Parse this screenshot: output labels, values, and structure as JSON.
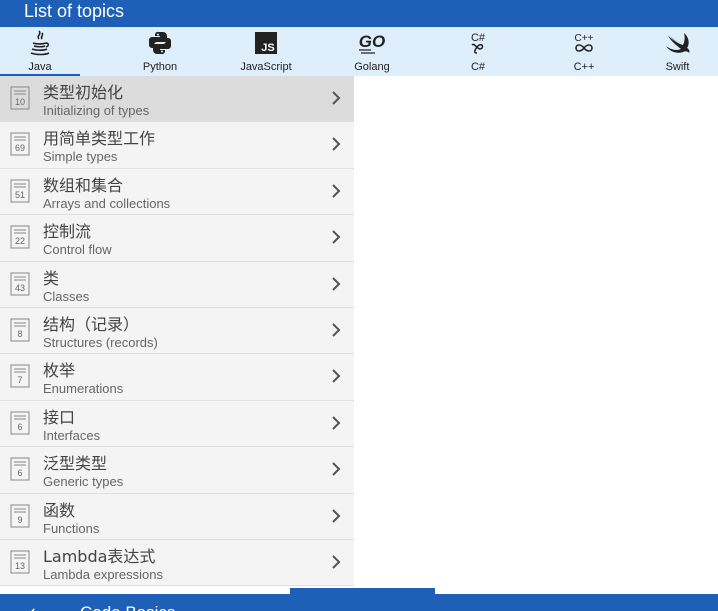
{
  "header": {
    "title": "List of topics"
  },
  "tabs": [
    {
      "label": "Java",
      "icon": "java-icon"
    },
    {
      "label": "Python",
      "icon": "python-icon"
    },
    {
      "label": "JavaScript",
      "icon": "javascript-icon"
    },
    {
      "label": "Golang",
      "icon": "golang-icon"
    },
    {
      "label": "C#",
      "icon": "csharp-icon"
    },
    {
      "label": "C++",
      "icon": "cpp-icon"
    },
    {
      "label": "Swift",
      "icon": "swift-icon"
    }
  ],
  "topics": [
    {
      "count": "10",
      "zh": "类型初始化",
      "en": "Initializing of types"
    },
    {
      "count": "69",
      "zh": "用简单类型工作",
      "en": "Simple types"
    },
    {
      "count": "51",
      "zh": "数组和集合",
      "en": "Arrays and collections"
    },
    {
      "count": "22",
      "zh": "控制流",
      "en": "Control flow"
    },
    {
      "count": "43",
      "zh": "类",
      "en": "Classes"
    },
    {
      "count": "8",
      "zh": "结构（记录）",
      "en": "Structures (records)"
    },
    {
      "count": "7",
      "zh": "枚举",
      "en": "Enumerations"
    },
    {
      "count": "6",
      "zh": "接口",
      "en": "Interfaces"
    },
    {
      "count": "6",
      "zh": "泛型类型",
      "en": "Generic types"
    },
    {
      "count": "9",
      "zh": "函数",
      "en": "Functions"
    },
    {
      "count": "13",
      "zh": "Lambda表达式",
      "en": "Lambda expressions"
    }
  ],
  "footer": {
    "back": "←",
    "app_name": "Code Basics"
  },
  "colors": {
    "primary": "#1e5fb8",
    "tab_bg": "#dfeefb",
    "selected_row": "#dcdcdc"
  }
}
